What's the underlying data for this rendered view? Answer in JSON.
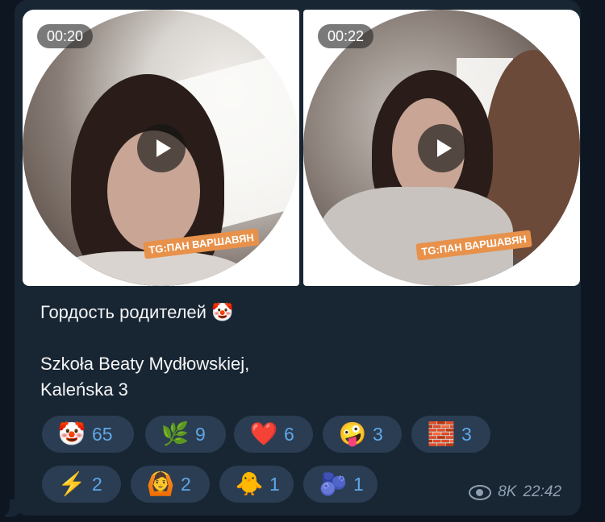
{
  "videos": [
    {
      "duration": "00:20",
      "watermark": "TG:ПАН ВАРШАВЯН"
    },
    {
      "duration": "00:22",
      "watermark": "TG:ПАН ВАРШАВЯН"
    }
  ],
  "message": {
    "line1": "Гордость родителей 🤡",
    "line2": "Szkoła Beaty Mydłowskiej,",
    "line3": "Kaleńska 3"
  },
  "reactions": [
    {
      "emoji": "🤡",
      "icon": "clown-face-icon",
      "count": "65"
    },
    {
      "emoji": "🌿",
      "icon": "cannabis-leaf-icon",
      "count": "9"
    },
    {
      "emoji": "❤️",
      "icon": "red-heart-icon",
      "count": "6"
    },
    {
      "emoji": "🤪",
      "icon": "crazy-face-sticker-icon",
      "count": "3"
    },
    {
      "emoji": "🧱",
      "icon": "glowing-block-sticker-icon",
      "count": "3"
    },
    {
      "emoji": "⚡",
      "icon": "lightning-icon",
      "count": "2"
    },
    {
      "emoji": "🙆",
      "icon": "anime-girl-sticker-icon",
      "count": "2"
    },
    {
      "emoji": "🐥",
      "icon": "pikachu-sticker-icon",
      "count": "1"
    },
    {
      "emoji": "🫐",
      "icon": "blue-blob-sticker-icon",
      "count": "1"
    }
  ],
  "meta": {
    "views": "8K",
    "time": "22:42"
  },
  "colors": {
    "background": "#0e1621",
    "bubble": "#182533",
    "reaction_bg": "#2b3d52",
    "accent": "#5fa7e8",
    "watermark": "#e8914a"
  }
}
